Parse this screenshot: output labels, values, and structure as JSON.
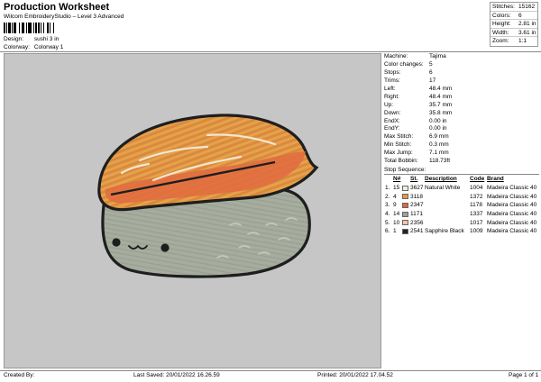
{
  "header": {
    "title": "Production Worksheet",
    "subtitle": "Wilcom EmbroideryStudio – Level 3 Advanced",
    "design_label": "Design:",
    "design_value": "sushi 3 in",
    "colorway_label": "Colorway:",
    "colorway_value": "Colorway 1"
  },
  "summary": [
    {
      "label": "Stitches:",
      "value": "15162"
    },
    {
      "label": "Colors:",
      "value": "6"
    },
    {
      "label": "Height:",
      "value": "2.81 in"
    },
    {
      "label": "Width:",
      "value": "3.61 in"
    },
    {
      "label": "Zoom:",
      "value": "1:1"
    }
  ],
  "machine_stats": [
    {
      "label": "Machine:",
      "value": "Tajima"
    },
    {
      "label": "Color changes:",
      "value": "5"
    },
    {
      "label": "Stops:",
      "value": "6"
    },
    {
      "label": "Trims:",
      "value": "17"
    },
    {
      "label": "Left:",
      "value": "48.4 mm"
    },
    {
      "label": "Right:",
      "value": "48.4 mm"
    },
    {
      "label": "Up:",
      "value": "35.7 mm"
    },
    {
      "label": "Down:",
      "value": "35.8 mm"
    },
    {
      "label": "EndX:",
      "value": "0.00 in"
    },
    {
      "label": "EndY:",
      "value": "0.00 in"
    },
    {
      "label": "Max Stitch:",
      "value": "6.9 mm"
    },
    {
      "label": "Min Stitch:",
      "value": "0.3 mm"
    },
    {
      "label": "Max Jump:",
      "value": "7.1 mm"
    },
    {
      "label": "Total Bobbin:",
      "value": "118.73ft"
    }
  ],
  "stop_sequence": {
    "title": "Stop Sequence:",
    "headers": {
      "n": "N#",
      "st": "St.",
      "description": "Description",
      "code": "Code",
      "brand": "Brand"
    },
    "rows": [
      {
        "num": "1.",
        "n": "15",
        "color": "#f2ece0",
        "st": "3627",
        "description": "Natural White",
        "code": "1004",
        "brand": "Madeira Classic 40"
      },
      {
        "num": "2.",
        "n": "4",
        "color": "#e8954e",
        "st": "3118",
        "description": "",
        "code": "1372",
        "brand": "Madeira Classic 40"
      },
      {
        "num": "3.",
        "n": "9",
        "color": "#e0683a",
        "st": "2347",
        "description": "",
        "code": "1178",
        "brand": "Madeira Classic 40"
      },
      {
        "num": "4.",
        "n": "14",
        "color": "#9aa396",
        "st": "1171",
        "description": "",
        "code": "1337",
        "brand": "Madeira Classic 40"
      },
      {
        "num": "5.",
        "n": "10",
        "color": "#ffc2a6",
        "st": "2356",
        "description": "",
        "code": "1017",
        "brand": "Madeira Classic 40"
      },
      {
        "num": "6.",
        "n": "1",
        "color": "#222222",
        "st": "2541",
        "description": "Sapphire Black",
        "code": "1009",
        "brand": "Madeira Classic 40"
      }
    ]
  },
  "footer": {
    "created_by": "Created By:",
    "last_saved": "Last Saved: 20/01/2022 16.26.59",
    "printed": "Printed: 20/01/2022 17.04.52",
    "page": "Page 1 of 1"
  },
  "colors": {
    "canvas_bg": "#c6c6c6",
    "rice": "#a4ab9c",
    "salmon_orange": "#e07a3c",
    "salmon_yellow": "#e8a948",
    "outline": "#1e1e1e"
  }
}
